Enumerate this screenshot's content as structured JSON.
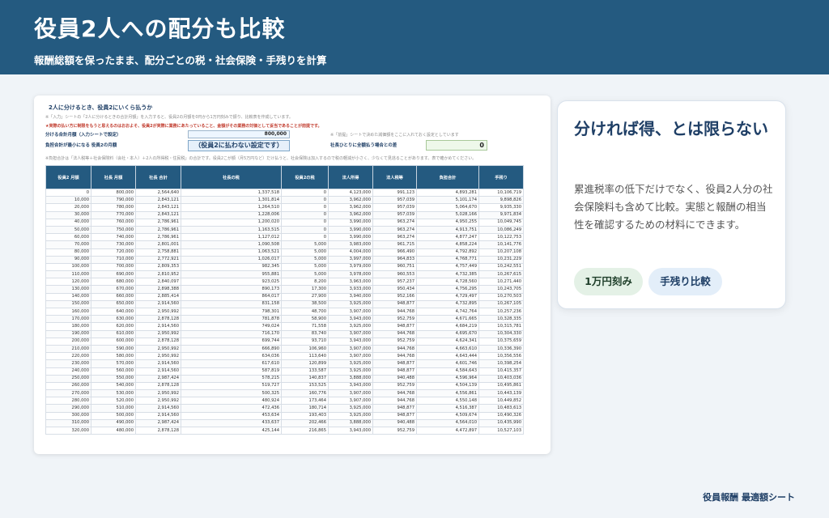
{
  "header": {
    "title": "役員2人への配分も比較",
    "subtitle": "報酬総額を保ったまま、配分ごとの税・社会保険・手残りを計算"
  },
  "sheet": {
    "title": "2人に分けるとき、役員2にいくら払うか",
    "note1": "※「入力」シートの「2人に分けるときの合計月額」を入力すると、役員2の月額を0円から1万円刻みで振り、比較表を作成しています。",
    "red_note": "★実際の払い方に制限をもうと思えるのはおおよそ、役員2が実際に業務にあたっていること、金額がその業務の対価として妥当であることが前提です。",
    "total_label": "分ける合計月額（入力シートで設定）",
    "total_value": "800,000",
    "min_label": "負担合計が最小になる 役員2の月額",
    "min_pill": "（役員2に払わない設定です）",
    "right_note": "※「前提」シートで決めた減価額をここに入れておく設定としています",
    "single_label": "社長ひとりに全額払う場合との差",
    "single_value": "0",
    "note2": "※負担合計は「法人税等＋社会保険料（会社・本人）＋2人の所得税・住民税」の合計です。役員2こが額（月5万円など）だけ払うと、社会保険は加入するので税の軽減が小さく、少なくて見逃ることがあります。表で確かめてください。",
    "columns": [
      "役員2 月額",
      "社長 月額",
      "社長 合計",
      "社長の税",
      "役員2の税",
      "法人所得",
      "法人税等",
      "負担合計",
      "手残り"
    ],
    "rows": [
      [
        "0",
        "800,000",
        "2,564,640",
        "1,337,518",
        "0",
        "4,123,000",
        "991,123",
        "4,893,281",
        "10,106,719"
      ],
      [
        "10,000",
        "790,000",
        "2,843,121",
        "1,301,814",
        "0",
        "3,962,000",
        "957,039",
        "5,101,174",
        "9,898,826"
      ],
      [
        "20,000",
        "780,000",
        "2,843,121",
        "1,264,510",
        "0",
        "3,962,000",
        "957,039",
        "5,064,670",
        "9,935,330"
      ],
      [
        "30,000",
        "770,000",
        "2,843,121",
        "1,228,006",
        "0",
        "3,962,000",
        "957,039",
        "5,028,166",
        "9,971,834"
      ],
      [
        "40,000",
        "760,000",
        "2,786,961",
        "1,200,020",
        "0",
        "3,990,000",
        "963,274",
        "4,950,255",
        "10,049,745"
      ],
      [
        "50,000",
        "750,000",
        "2,786,961",
        "1,163,515",
        "0",
        "3,990,000",
        "963,274",
        "4,913,751",
        "10,086,249"
      ],
      [
        "60,000",
        "740,000",
        "2,786,961",
        "1,127,012",
        "0",
        "3,990,000",
        "963,274",
        "4,877,247",
        "10,122,753"
      ],
      [
        "70,000",
        "730,000",
        "2,801,001",
        "1,090,508",
        "5,000",
        "3,983,000",
        "961,715",
        "4,858,224",
        "10,141,776"
      ],
      [
        "80,000",
        "720,000",
        "2,758,881",
        "1,063,521",
        "5,000",
        "4,004,000",
        "966,490",
        "4,792,892",
        "10,207,108"
      ],
      [
        "90,000",
        "710,000",
        "2,772,921",
        "1,026,017",
        "5,000",
        "3,997,000",
        "964,833",
        "4,768,771",
        "10,231,229"
      ],
      [
        "100,000",
        "700,000",
        "2,809,353",
        "982,345",
        "5,000",
        "3,979,000",
        "960,751",
        "4,757,449",
        "10,242,551"
      ],
      [
        "110,000",
        "690,000",
        "2,810,952",
        "955,881",
        "5,000",
        "3,978,000",
        "960,553",
        "4,732,385",
        "10,267,615"
      ],
      [
        "120,000",
        "680,000",
        "2,840,097",
        "923,025",
        "8,200",
        "3,963,000",
        "957,237",
        "4,728,560",
        "10,271,440"
      ],
      [
        "130,000",
        "670,000",
        "2,898,388",
        "890,173",
        "17,300",
        "3,933,000",
        "950,434",
        "4,756,295",
        "10,243,705"
      ],
      [
        "140,000",
        "660,000",
        "2,885,414",
        "864,017",
        "27,900",
        "3,940,000",
        "952,166",
        "4,729,497",
        "10,270,503"
      ],
      [
        "150,000",
        "650,000",
        "2,914,560",
        "831,158",
        "38,500",
        "3,925,000",
        "948,877",
        "4,732,895",
        "10,267,105"
      ],
      [
        "160,000",
        "640,000",
        "2,950,992",
        "798,301",
        "48,700",
        "3,907,000",
        "944,768",
        "4,742,764",
        "10,257,236"
      ],
      [
        "170,000",
        "630,000",
        "2,878,128",
        "781,878",
        "58,900",
        "3,943,000",
        "952,759",
        "4,671,665",
        "10,328,335"
      ],
      [
        "180,000",
        "620,000",
        "2,914,560",
        "749,024",
        "71,558",
        "3,925,000",
        "948,877",
        "4,684,219",
        "10,315,781"
      ],
      [
        "190,000",
        "610,000",
        "2,950,992",
        "716,170",
        "83,740",
        "3,907,000",
        "944,768",
        "4,695,670",
        "10,304,330"
      ],
      [
        "200,000",
        "600,000",
        "2,878,128",
        "699,744",
        "93,710",
        "3,943,000",
        "952,759",
        "4,624,341",
        "10,375,659"
      ],
      [
        "210,000",
        "590,000",
        "2,950,992",
        "666,890",
        "106,960",
        "3,907,000",
        "944,768",
        "4,663,610",
        "10,336,390"
      ],
      [
        "220,000",
        "580,000",
        "2,950,992",
        "634,036",
        "113,640",
        "3,907,000",
        "944,768",
        "4,643,444",
        "10,356,556"
      ],
      [
        "230,000",
        "570,000",
        "2,914,560",
        "617,610",
        "120,899",
        "3,925,000",
        "948,877",
        "4,601,746",
        "10,398,254"
      ],
      [
        "240,000",
        "560,000",
        "2,914,560",
        "587,819",
        "133,587",
        "3,925,000",
        "948,877",
        "4,584,643",
        "10,415,357"
      ],
      [
        "250,000",
        "550,000",
        "2,987,424",
        "578,215",
        "140,837",
        "3,888,000",
        "940,488",
        "4,596,964",
        "10,403,036"
      ],
      [
        "260,000",
        "540,000",
        "2,878,128",
        "519,727",
        "153,525",
        "3,943,000",
        "952,759",
        "4,504,139",
        "10,495,861"
      ],
      [
        "270,000",
        "530,000",
        "2,950,992",
        "500,325",
        "160,776",
        "3,907,000",
        "944,768",
        "4,556,861",
        "10,443,139"
      ],
      [
        "280,000",
        "520,000",
        "2,950,992",
        "480,924",
        "173,464",
        "3,907,000",
        "944,768",
        "4,550,148",
        "10,449,852"
      ],
      [
        "290,000",
        "510,000",
        "2,914,560",
        "472,436",
        "180,714",
        "3,925,000",
        "948,877",
        "4,516,387",
        "10,483,613"
      ],
      [
        "300,000",
        "500,000",
        "2,914,560",
        "453,634",
        "193,403",
        "3,925,000",
        "948,877",
        "4,509,674",
        "10,490,326"
      ],
      [
        "310,000",
        "490,000",
        "2,987,424",
        "433,637",
        "202,466",
        "3,888,000",
        "940,488",
        "4,564,010",
        "10,435,990"
      ],
      [
        "320,000",
        "480,000",
        "2,878,128",
        "425,144",
        "216,865",
        "3,943,000",
        "952,759",
        "4,472,897",
        "10,527,103"
      ]
    ]
  },
  "card": {
    "title": "分ければ得、とは限らない",
    "body": "累進税率の低下だけでなく、役員2人分の社会保険料も含めて比較。実態と報酬の相当性を確認するための材料にできます。",
    "tags": [
      "1万円刻み",
      "手残り比較"
    ]
  },
  "footer": {
    "text": "役員報酬 最適額シート"
  },
  "colors": {
    "header_bg": "#245a80",
    "table_header": "#245a80",
    "tag_green": "#e4f1e6",
    "tag_blue": "#e3eef9"
  }
}
